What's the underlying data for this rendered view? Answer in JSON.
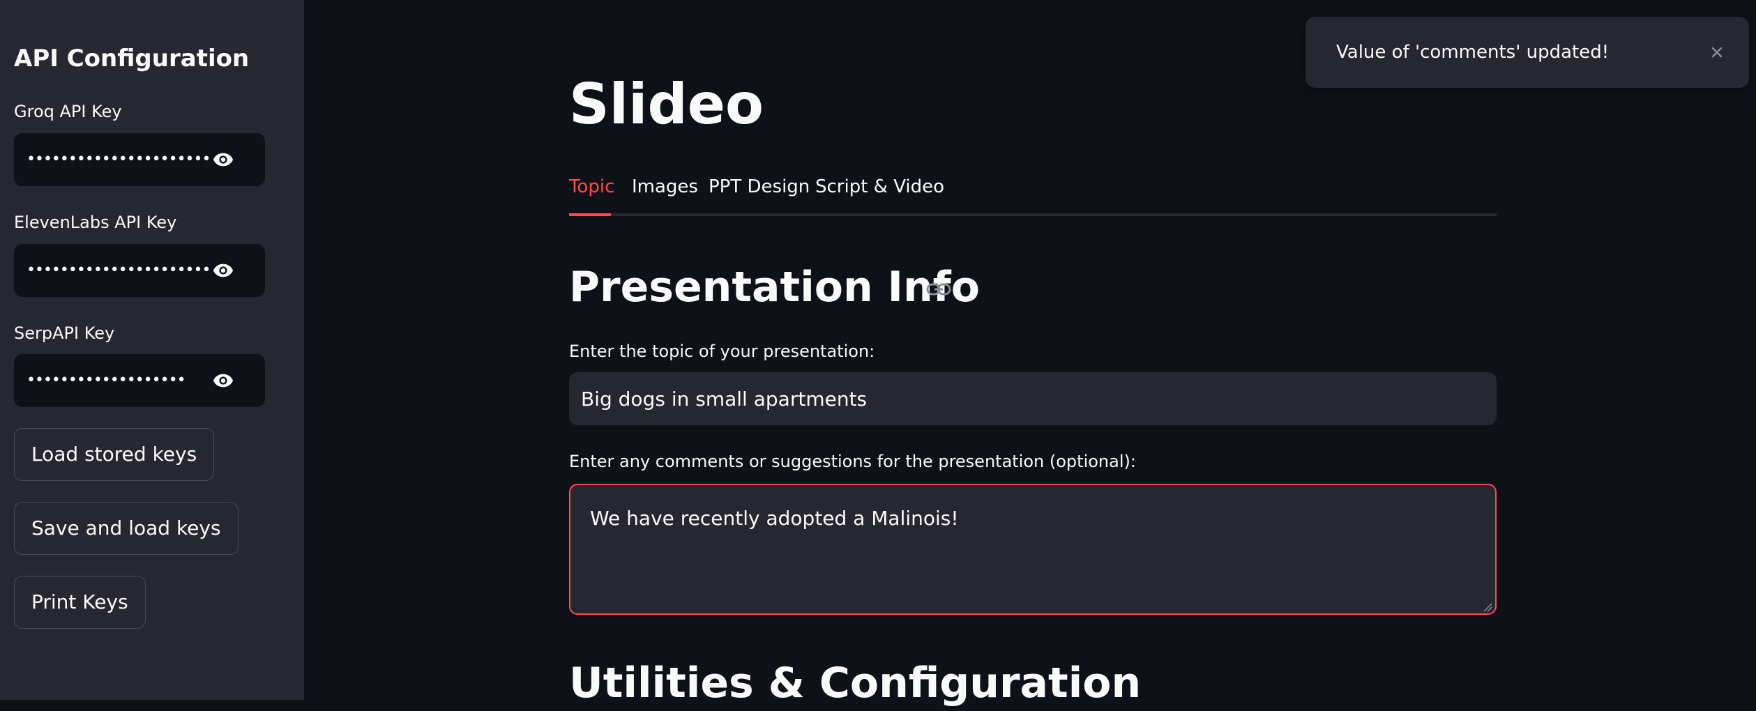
{
  "sidebar": {
    "title": "API Configuration",
    "fields": [
      {
        "label": "Groq API Key",
        "masked": "••••••••••••••••••••••"
      },
      {
        "label": "ElevenLabs API Key",
        "masked": "••••••••••••••••••••••"
      },
      {
        "label": "SerpAPI Key",
        "masked": "•••••••••••••••••••"
      }
    ],
    "buttons": {
      "load": "Load stored keys",
      "save": "Save and load keys",
      "print": "Print Keys"
    }
  },
  "main": {
    "app_title": "Slideo",
    "tabs": [
      {
        "label": "Topic",
        "active": true
      },
      {
        "label": "Images",
        "active": false
      },
      {
        "label": "PPT Design",
        "active": false
      },
      {
        "label": "Script & Video",
        "active": false
      }
    ],
    "section_title": "Presentation Info",
    "topic_label": "Enter the topic of your presentation:",
    "topic_value": "Big dogs in small apartments",
    "comments_label": "Enter any comments or suggestions for the presentation (optional):",
    "comments_value": "We have recently adopted a Malinois!",
    "next_section_title": "Utilities & Configuration"
  },
  "toast": {
    "message": "Value of 'comments' updated!"
  },
  "colors": {
    "background": "#0e1117",
    "sidebar": "#262730",
    "accent": "#ff4b4b",
    "text": "#fafafa"
  },
  "icons": [
    "eye-icon",
    "link-icon",
    "close-icon",
    "resize-handle-icon"
  ]
}
